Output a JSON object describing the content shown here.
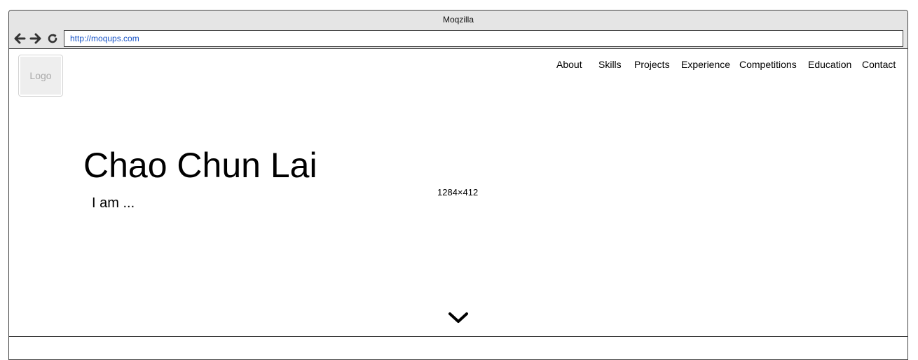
{
  "window": {
    "title": "Moqzilla"
  },
  "browser": {
    "url": "http://moqups.com",
    "back_icon": "arrow-left-icon",
    "forward_icon": "arrow-right-icon",
    "reload_icon": "reload-icon"
  },
  "header": {
    "logo_label": "Logo",
    "nav": [
      "About",
      "Skills",
      "Projects",
      "Experience",
      "Competitions",
      "Education",
      "Contact"
    ]
  },
  "hero": {
    "name": "Chao Chun Lai",
    "tagline": "I am ...",
    "size_label": "1284×412",
    "scroll_icon": "chevron-down-icon"
  }
}
